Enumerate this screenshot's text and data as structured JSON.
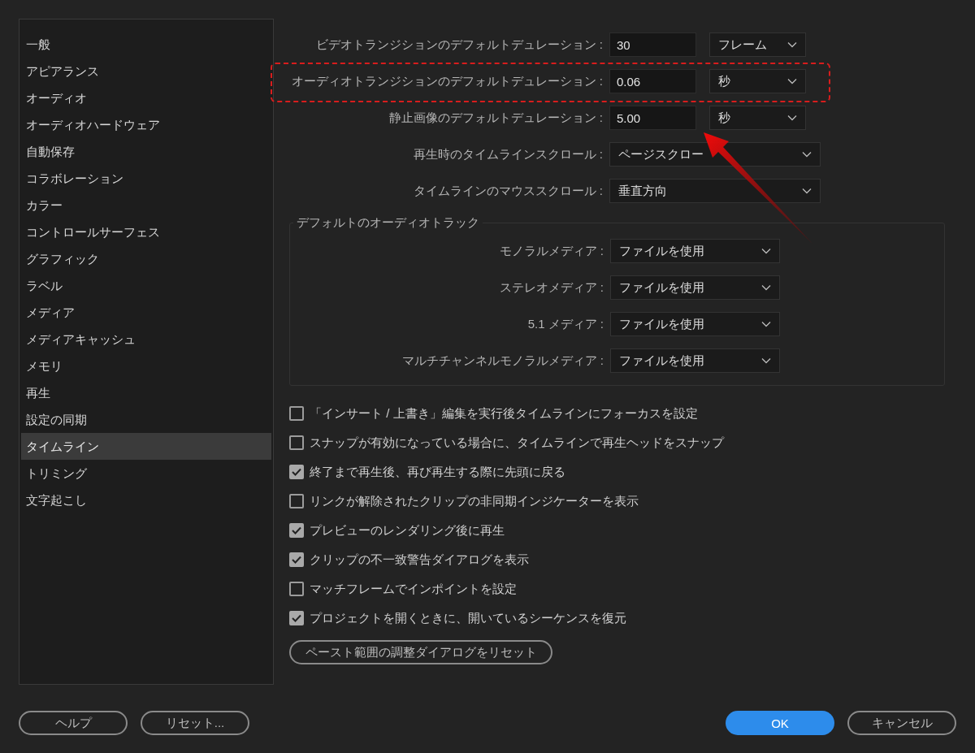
{
  "sidebar": {
    "items": [
      {
        "label": "一般",
        "selected": false
      },
      {
        "label": "アピアランス",
        "selected": false
      },
      {
        "label": "オーディオ",
        "selected": false
      },
      {
        "label": "オーディオハードウェア",
        "selected": false
      },
      {
        "label": "自動保存",
        "selected": false
      },
      {
        "label": "コラボレーション",
        "selected": false
      },
      {
        "label": "カラー",
        "selected": false
      },
      {
        "label": "コントロールサーフェス",
        "selected": false
      },
      {
        "label": "グラフィック",
        "selected": false
      },
      {
        "label": "ラベル",
        "selected": false
      },
      {
        "label": "メディア",
        "selected": false
      },
      {
        "label": "メディアキャッシュ",
        "selected": false
      },
      {
        "label": "メモリ",
        "selected": false
      },
      {
        "label": "再生",
        "selected": false
      },
      {
        "label": "設定の同期",
        "selected": false
      },
      {
        "label": "タイムライン",
        "selected": true
      },
      {
        "label": "トリミング",
        "selected": false
      },
      {
        "label": "文字起こし",
        "selected": false
      }
    ]
  },
  "settings": [
    {
      "kind": "field_unit",
      "label": "ビデオトランジションのデフォルトデュレーション :",
      "value": "30",
      "unit": "フレーム",
      "highlighted": false
    },
    {
      "kind": "field_unit",
      "label": "オーディオトランジションのデフォルトデュレーション :",
      "value": "0.06",
      "unit": "秒",
      "highlighted": true
    },
    {
      "kind": "field_unit",
      "label": "静止画像のデフォルトデュレーション :",
      "value": "5.00",
      "unit": "秒",
      "highlighted": false
    },
    {
      "kind": "dropdown",
      "label": "再生時のタイムラインスクロール :",
      "value": "ページスクロー",
      "highlighted": false
    },
    {
      "kind": "dropdown",
      "label": "タイムラインのマウススクロール :",
      "value": "垂直方向",
      "highlighted": false
    }
  ],
  "audio_tracks": {
    "title": "デフォルトのオーディオトラック",
    "rows": [
      {
        "label": "モノラルメディア :",
        "value": "ファイルを使用"
      },
      {
        "label": "ステレオメディア :",
        "value": "ファイルを使用"
      },
      {
        "label": "5.1 メディア :",
        "value": "ファイルを使用"
      },
      {
        "label": "マルチチャンネルモノラルメディア :",
        "value": "ファイルを使用"
      }
    ]
  },
  "options": [
    {
      "label": "「インサート / 上書き」編集を実行後タイムラインにフォーカスを設定",
      "checked": false
    },
    {
      "label": "スナップが有効になっている場合に、タイムラインで再生ヘッドをスナップ",
      "checked": false
    },
    {
      "label": "終了まで再生後、再び再生する際に先頭に戻る",
      "checked": true
    },
    {
      "label": "リンクが解除されたクリップの非同期インジケーターを表示",
      "checked": false
    },
    {
      "label": "プレビューのレンダリング後に再生",
      "checked": true
    },
    {
      "label": "クリップの不一致警告ダイアログを表示",
      "checked": true
    },
    {
      "label": "マッチフレームでインポイントを設定",
      "checked": false
    },
    {
      "label": "プロジェクトを開くときに、開いているシーケンスを復元",
      "checked": true
    }
  ],
  "reset_paste_button": "ペースト範囲の調整ダイアログをリセット",
  "footer_buttons": [
    {
      "label": "ヘルプ",
      "kind": "secondary"
    },
    {
      "label": "リセット...",
      "kind": "secondary"
    },
    {
      "label": "OK",
      "kind": "primary"
    },
    {
      "label": "キャンセル",
      "kind": "secondary"
    }
  ]
}
